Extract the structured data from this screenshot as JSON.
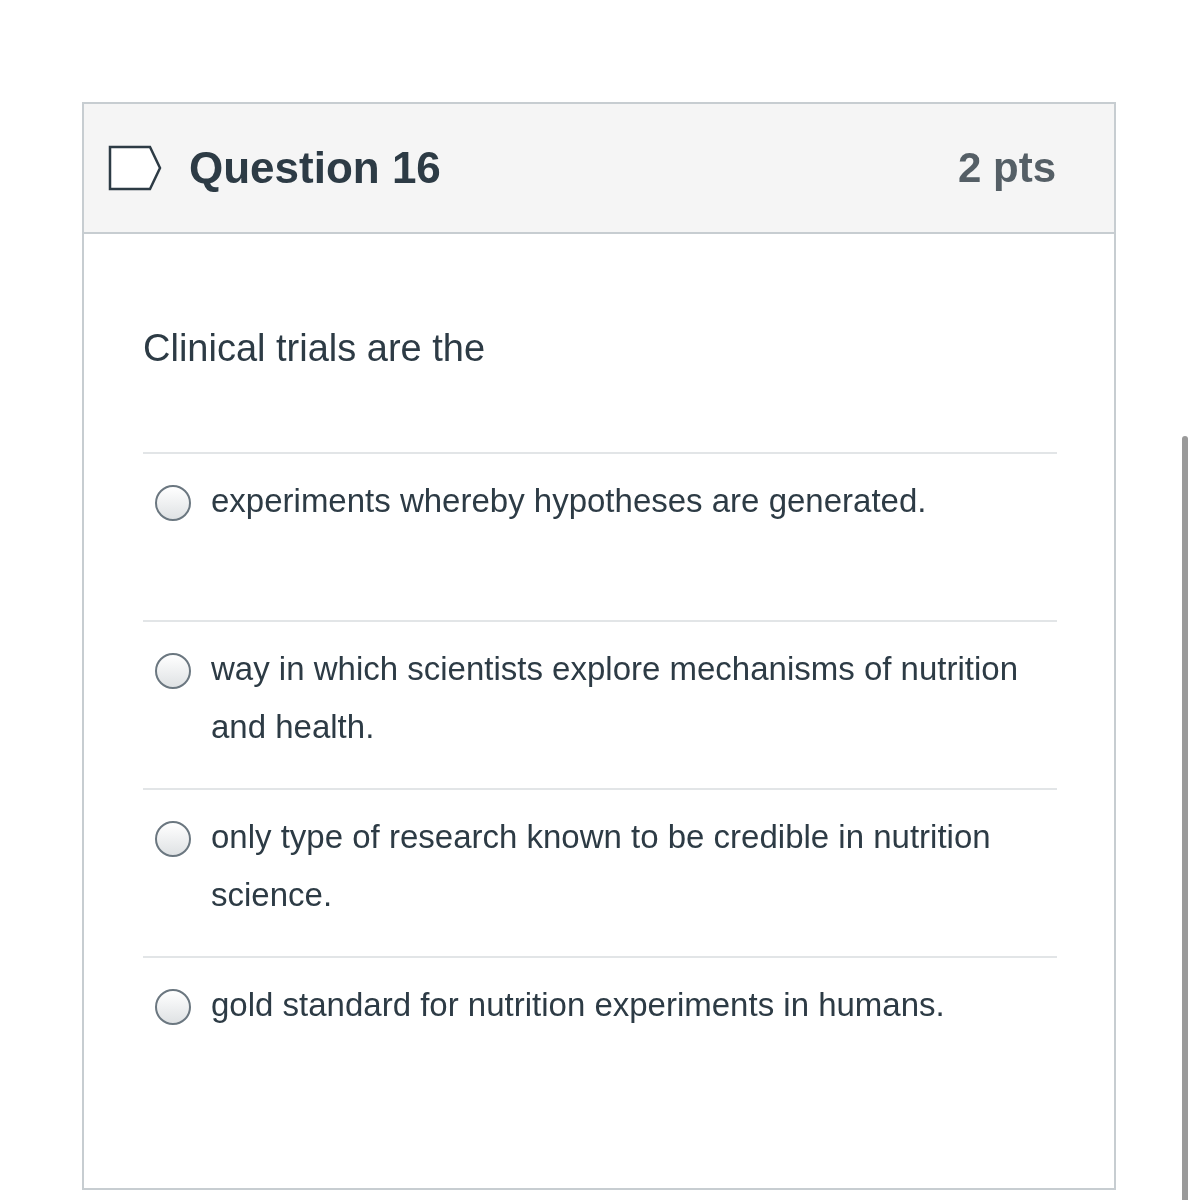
{
  "question": {
    "title": "Question 16",
    "points": "2 pts",
    "flagged": false,
    "text": "Clinical trials are the",
    "answers": [
      {
        "text": "experiments whereby hypotheses are generated.",
        "selected": false
      },
      {
        "text": "way in which scientists explore mechanisms of nutrition and health.",
        "selected": false
      },
      {
        "text": "only type of research known to be credible in nutrition science.",
        "selected": false
      },
      {
        "text": "gold standard for nutrition experiments in humans.",
        "selected": false
      }
    ]
  }
}
